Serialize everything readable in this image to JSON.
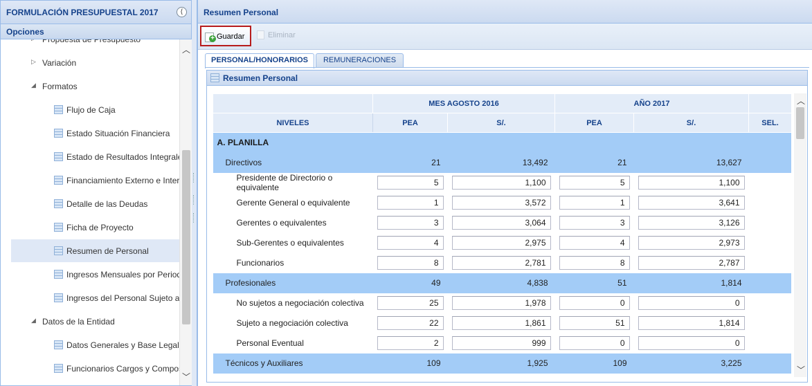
{
  "left": {
    "title": "FORMULACIÓN PRESUPUESTAL 2017",
    "collapse_glyph": "⟨",
    "opciones": "Opciones",
    "tree": [
      {
        "label": "Propuesta de Presupuesto",
        "type": "folder-collapsed",
        "icon": "triangle-right-icon"
      },
      {
        "label": "Variación",
        "type": "folder-collapsed",
        "icon": "triangle-right-icon"
      },
      {
        "label": "Formatos",
        "type": "folder-expanded",
        "icon": "triangle-down-icon"
      },
      {
        "label": "Flujo de Caja",
        "type": "leaf",
        "icon": "grid-icon"
      },
      {
        "label": "Estado Situación Financiera",
        "type": "leaf",
        "icon": "grid-icon"
      },
      {
        "label": "Estado de Resultados Integrales",
        "type": "leaf",
        "icon": "grid-icon"
      },
      {
        "label": "Financiamiento Externo e Interno",
        "type": "leaf",
        "icon": "grid-icon"
      },
      {
        "label": "Detalle de las Deudas",
        "type": "leaf",
        "icon": "grid-icon"
      },
      {
        "label": "Ficha de Proyecto",
        "type": "leaf",
        "icon": "grid-icon"
      },
      {
        "label": "Resumen de Personal",
        "type": "leaf",
        "icon": "grid-icon",
        "selected": true
      },
      {
        "label": "Ingresos Mensuales por Periodo",
        "type": "leaf",
        "icon": "grid-icon"
      },
      {
        "label": "Ingresos del Personal Sujeto a C",
        "type": "leaf",
        "icon": "grid-icon"
      },
      {
        "label": "Datos de la Entidad",
        "type": "folder-expanded",
        "icon": "triangle-down-icon"
      },
      {
        "label": "Datos Generales y Base Legal",
        "type": "leaf",
        "icon": "grid-icon"
      },
      {
        "label": "Funcionarios Cargos y Composic",
        "type": "leaf",
        "icon": "grid-icon"
      }
    ]
  },
  "right": {
    "title": "Resumen Personal",
    "toolbar": {
      "save_label": "Guardar",
      "delete_label": "Eliminar"
    },
    "tabs": [
      {
        "label": "PERSONAL/HONORARIOS",
        "active": true
      },
      {
        "label": "REMUNERACIONES",
        "active": false
      }
    ],
    "panel_title": "Resumen Personal",
    "table": {
      "group_headers": [
        "MES AGOSTO 2016",
        "AÑO 2017"
      ],
      "columns": [
        "NIVELES",
        "PEA",
        "S/.",
        "PEA",
        "S/.",
        "SEL."
      ],
      "rows": [
        {
          "kind": "section",
          "name": "A. PLANILLA"
        },
        {
          "kind": "cat",
          "name": "Directivos",
          "v": [
            "21",
            "13,492",
            "21",
            "13,627"
          ]
        },
        {
          "kind": "item",
          "name": "Presidente de Directorio o equivalente",
          "v": [
            "5",
            "1,100",
            "5",
            "1,100"
          ]
        },
        {
          "kind": "item",
          "name": "Gerente General o equivalente",
          "v": [
            "1",
            "3,572",
            "1",
            "3,641"
          ]
        },
        {
          "kind": "item",
          "name": "Gerentes o equivalentes",
          "v": [
            "3",
            "3,064",
            "3",
            "3,126"
          ]
        },
        {
          "kind": "item",
          "name": "Sub-Gerentes o equivalentes",
          "v": [
            "4",
            "2,975",
            "4",
            "2,973"
          ]
        },
        {
          "kind": "item",
          "name": "Funcionarios",
          "v": [
            "8",
            "2,781",
            "8",
            "2,787"
          ]
        },
        {
          "kind": "cat",
          "name": "Profesionales",
          "v": [
            "49",
            "4,838",
            "51",
            "1,814"
          ]
        },
        {
          "kind": "item",
          "name": "No sujetos a negociación colectiva",
          "v": [
            "25",
            "1,978",
            "0",
            "0"
          ]
        },
        {
          "kind": "item",
          "name": "Sujeto a negociación colectiva",
          "v": [
            "22",
            "1,861",
            "51",
            "1,814"
          ]
        },
        {
          "kind": "item",
          "name": "Personal Eventual",
          "v": [
            "2",
            "999",
            "0",
            "0"
          ]
        },
        {
          "kind": "cat",
          "name": "Técnicos y Auxiliares",
          "v": [
            "109",
            "1,925",
            "109",
            "3,225"
          ]
        }
      ]
    }
  }
}
